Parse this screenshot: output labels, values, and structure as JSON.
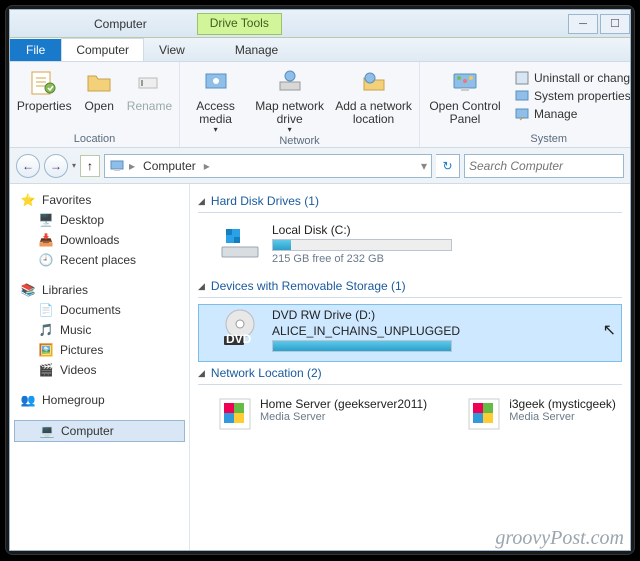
{
  "title": "Computer",
  "drive_tools": "Drive Tools",
  "tabs": {
    "file": "File",
    "computer": "Computer",
    "view": "View",
    "manage": "Manage"
  },
  "ribbon": {
    "location": {
      "properties": "Properties",
      "open": "Open",
      "rename": "Rename",
      "label": "Location"
    },
    "network": {
      "access": "Access media",
      "map": "Map network drive",
      "add": "Add a network location",
      "label": "Network"
    },
    "system": {
      "panel": "Open Control Panel",
      "uninstall": "Uninstall or change a pro",
      "props": "System properties",
      "manage": "Manage",
      "label": "System"
    }
  },
  "nav": {
    "crumb1": "Computer",
    "search_placeholder": "Search Computer"
  },
  "sidebar": {
    "favorites": "Favorites",
    "desktop": "Desktop",
    "downloads": "Downloads",
    "recent": "Recent places",
    "libraries": "Libraries",
    "documents": "Documents",
    "music": "Music",
    "pictures": "Pictures",
    "videos": "Videos",
    "homegroup": "Homegroup",
    "computer": "Computer"
  },
  "content": {
    "hdd_head": "Hard Disk Drives (1)",
    "local_disk": "Local Disk (C:)",
    "local_free": "215 GB free of 232 GB",
    "local_fill_pct": 10,
    "removable_head": "Devices with Removable Storage (1)",
    "dvd_line1": "DVD RW Drive (D:)",
    "dvd_line2": "ALICE_IN_CHAINS_UNPLUGGED",
    "dvd_fill_pct": 100,
    "network_head": "Network Location (2)",
    "net1_title": "Home Server (geekserver2011)",
    "net1_sub": "Media Server",
    "net2_title": "i3geek (mysticgeek)",
    "net2_sub": "Media Server"
  },
  "watermark": "groovyPost.com"
}
